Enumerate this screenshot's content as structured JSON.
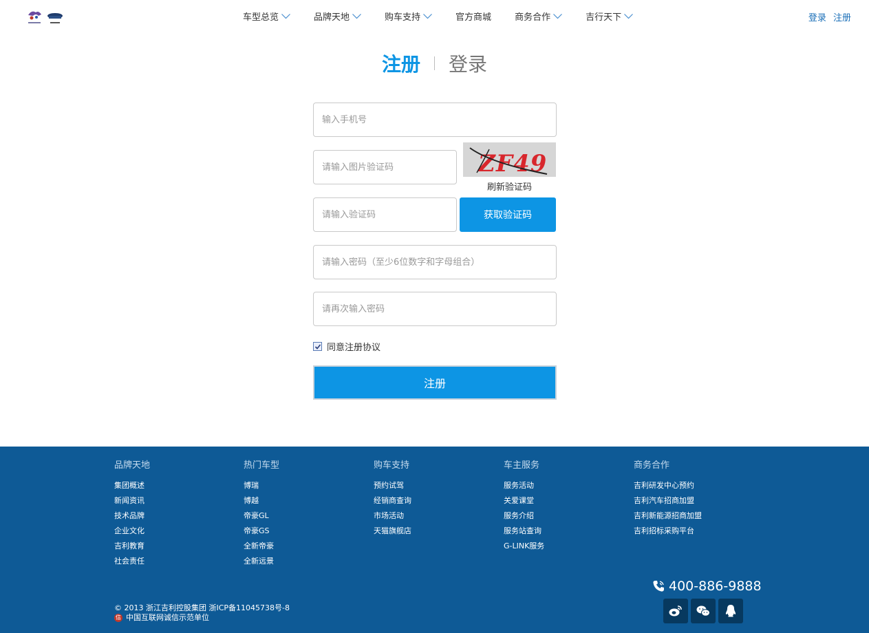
{
  "nav": {
    "items": [
      {
        "label": "车型总览",
        "dropdown": true
      },
      {
        "label": "品牌天地",
        "dropdown": true
      },
      {
        "label": "购车支持",
        "dropdown": true
      },
      {
        "label": "官方商城",
        "dropdown": false
      },
      {
        "label": "商务合作",
        "dropdown": true
      },
      {
        "label": "吉行天下",
        "dropdown": true
      }
    ],
    "login": "登录",
    "register": "注册"
  },
  "tabs": {
    "register": "注册",
    "login": "登录",
    "active": "register"
  },
  "form": {
    "phone_placeholder": "输入手机号",
    "image_code_placeholder": "请输入图片验证码",
    "captcha_text": "ZF49",
    "refresh_captcha": "刷新验证码",
    "sms_code_placeholder": "请输入验证码",
    "get_code_button": "获取验证码",
    "password_placeholder": "请输入密码（至少6位数字和字母组合）",
    "confirm_placeholder": "请再次输入密码",
    "agree_label": "同意注册协议",
    "agree_checked": true,
    "submit_label": "注册"
  },
  "footer": {
    "columns": [
      {
        "title": "品牌天地",
        "links": [
          "集团概述",
          "新闻资讯",
          "技术品牌",
          "企业文化",
          "吉利教育",
          "社会责任"
        ]
      },
      {
        "title": "热门车型",
        "links": [
          "博瑞",
          "博越",
          "帝豪GL",
          "帝豪GS",
          "全新帝豪",
          "全新远景"
        ]
      },
      {
        "title": "购车支持",
        "links": [
          "预约试驾",
          "经销商查询",
          "市场活动",
          "天猫旗舰店"
        ]
      },
      {
        "title": "车主服务",
        "links": [
          "服务活动",
          "关爱课堂",
          "服务介绍",
          "服务站查询",
          "G-LINK服务"
        ]
      },
      {
        "title": "商务合作",
        "links": [
          "吉利研发中心预约",
          "吉利汽车招商加盟",
          "吉利新能源招商加盟",
          "吉利招标采购平台"
        ]
      }
    ],
    "copyright": "© 2013 浙江吉利控股集团 浙ICP备11045738号-8",
    "trust_badge": "信",
    "trust_text": "中国互联网诚信示范单位",
    "phone": "400-886-9888",
    "social": [
      "weibo-icon",
      "wechat-icon",
      "qq-icon"
    ]
  },
  "colors": {
    "accent": "#0d95e4",
    "footer_bg": "#0e5a96",
    "link": "#1a6fb8"
  }
}
